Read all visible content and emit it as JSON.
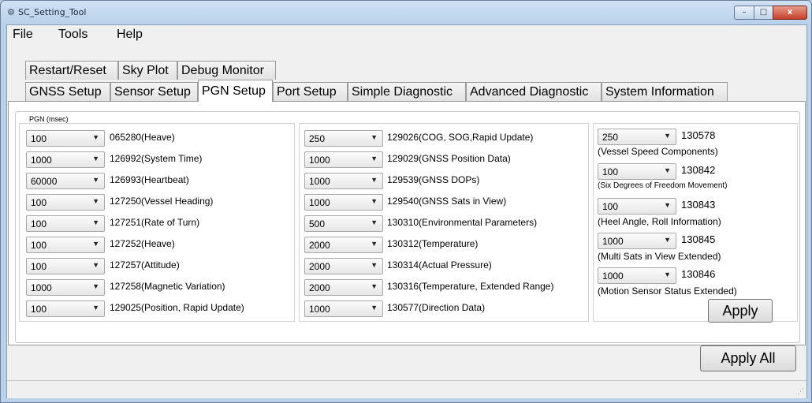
{
  "window": {
    "title": "SC_Setting_Tool",
    "app_icon": "app-icon",
    "controls": {
      "minimize": "–",
      "maximize": "□",
      "close": "x"
    }
  },
  "menu": {
    "items": [
      "File",
      "Tools",
      "Help"
    ]
  },
  "tabs_top": [
    "Restart/Reset",
    "Sky Plot",
    "Debug Monitor"
  ],
  "tabs_main": [
    "GNSS Setup",
    "Sensor Setup",
    "PGN Setup",
    "Port Setup",
    "Simple Diagnostic",
    "Advanced Diagnostic",
    "System Information"
  ],
  "active_tab": "PGN Setup",
  "group_title": "PGN (msec)",
  "columns": [
    {
      "rows": [
        {
          "value": "100",
          "label": "065280(Heave)"
        },
        {
          "value": "1000",
          "label": "126992(System Time)"
        },
        {
          "value": "60000",
          "label": "126993(Heartbeat)"
        },
        {
          "value": "100",
          "label": "127250(Vessel Heading)"
        },
        {
          "value": "100",
          "label": "127251(Rate of Turn)"
        },
        {
          "value": "100",
          "label": "127252(Heave)"
        },
        {
          "value": "100",
          "label": "127257(Attitude)"
        },
        {
          "value": "1000",
          "label": "127258(Magnetic Variation)"
        },
        {
          "value": "100",
          "label": "129025(Position, Rapid Update)"
        }
      ]
    },
    {
      "rows": [
        {
          "value": "250",
          "label": "129026(COG, SOG,Rapid Update)"
        },
        {
          "value": "1000",
          "label": "129029(GNSS Position Data)"
        },
        {
          "value": "1000",
          "label": "129539(GNSS DOPs)"
        },
        {
          "value": "1000",
          "label": "129540(GNSS Sats in View)"
        },
        {
          "value": "500",
          "label": "130310(Environmental Parameters)"
        },
        {
          "value": "2000",
          "label": "130312(Temperature)"
        },
        {
          "value": "2000",
          "label": "130314(Actual Pressure)"
        },
        {
          "value": "2000",
          "label": "130316(Temperature, Extended Range)"
        },
        {
          "value": "1000",
          "label": "130577(Direction Data)"
        }
      ]
    },
    {
      "rows": [
        {
          "value": "250",
          "code": "130578",
          "desc": "(Vessel Speed Components)"
        },
        {
          "value": "100",
          "code": "130842",
          "desc": "(Six Degrees of Freedom Movement)"
        },
        {
          "value": "100",
          "code": "130843",
          "desc": "(Heel Angle, Roll Information)"
        },
        {
          "value": "1000",
          "code": "130845",
          "desc": "(Multi Sats in View Extended)"
        },
        {
          "value": "1000",
          "code": "130846",
          "desc": "(Motion Sensor Status Extended)"
        }
      ]
    }
  ],
  "buttons": {
    "apply": "Apply",
    "apply_all": "Apply All"
  },
  "icons": {
    "dropdown": "chevron-down-icon",
    "resize_grip": "resize-grip-icon"
  }
}
